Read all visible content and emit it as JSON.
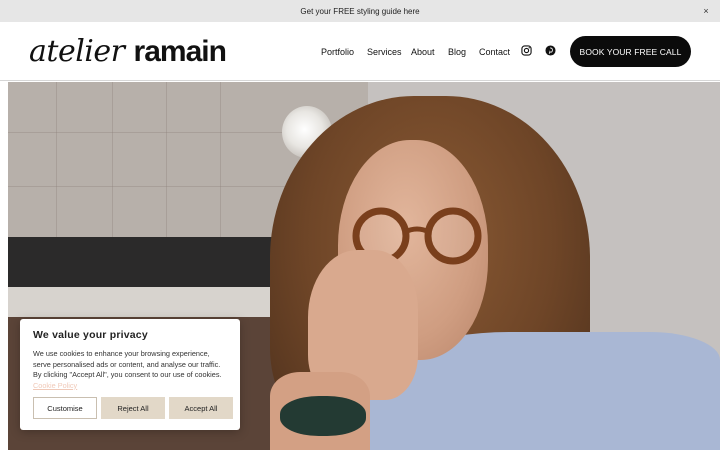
{
  "announcement": {
    "text": "Get your FREE styling guide here",
    "close_glyph": "×"
  },
  "header": {
    "logo_italic": "atelier",
    "logo_bold": "ramain",
    "nav": [
      "Portfolio",
      "Services",
      "About",
      "Blog",
      "Contact"
    ],
    "social_icons": [
      "instagram-icon",
      "pinterest-icon"
    ],
    "cta_label": "BOOK YOUR FREE CALL"
  },
  "cookie_banner": {
    "title": "We value your privacy",
    "body": "We use cookies to enhance your browsing experience, serve personalised ads or content, and analyse our traffic. By clicking \"Accept All\", you consent to our use of cookies.",
    "policy_link": "Cookie Policy",
    "buttons": {
      "customise": "Customise",
      "reject": "Reject All",
      "accept": "Accept All"
    }
  },
  "colors": {
    "announcement_bg": "#e6e6e6",
    "cta_bg": "#0b0b0b",
    "button_fill": "#e2d8c8",
    "policy_link": "#f0c9b8"
  }
}
